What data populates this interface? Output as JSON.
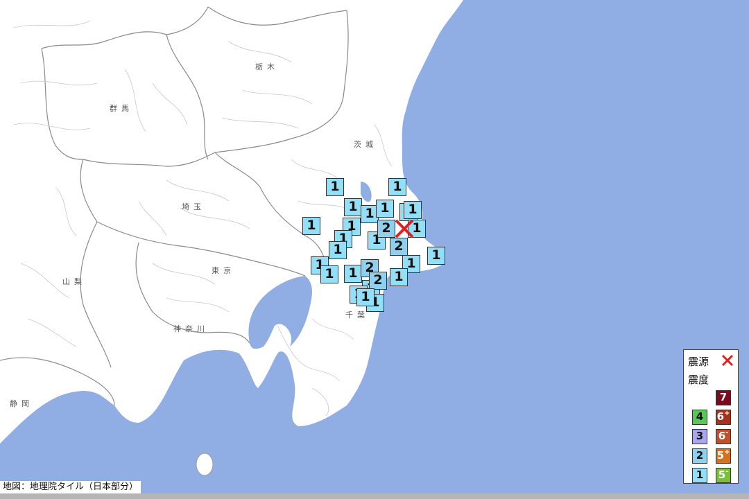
{
  "map": {
    "sea_color": "#91aee4",
    "land_color": "#ffffff",
    "prefectures": [
      {
        "id": "tochigi",
        "label": "栃木"
      },
      {
        "id": "gunma",
        "label": "群馬"
      },
      {
        "id": "ibaraki",
        "label": "茨城"
      },
      {
        "id": "saitama",
        "label": "埼玉"
      },
      {
        "id": "tokyo",
        "label": "東京"
      },
      {
        "id": "yamanashi",
        "label": "山梨"
      },
      {
        "id": "kanagawa",
        "label": "神奈川"
      },
      {
        "id": "chiba",
        "label": "千葉"
      },
      {
        "id": "shizuoka",
        "label": "静岡"
      }
    ],
    "epicenter": {
      "icon": "cross-mark-icon",
      "color": "#e02020"
    },
    "observations": [
      {
        "value": "1"
      },
      {
        "value": "1"
      },
      {
        "value": "1"
      },
      {
        "value": "1"
      },
      {
        "value": "1"
      },
      {
        "value": "1"
      },
      {
        "value": "1"
      },
      {
        "value": "1"
      },
      {
        "value": "1"
      },
      {
        "value": "1"
      },
      {
        "value": "1"
      },
      {
        "value": "1"
      },
      {
        "value": "1"
      },
      {
        "value": "1"
      },
      {
        "value": "1"
      },
      {
        "value": "1"
      },
      {
        "value": "1"
      },
      {
        "value": "1"
      },
      {
        "value": "1"
      },
      {
        "value": "1"
      },
      {
        "value": "1"
      },
      {
        "value": "2"
      },
      {
        "value": "2"
      },
      {
        "value": "2"
      },
      {
        "value": "2"
      },
      {
        "value": "1"
      },
      {
        "value": "1"
      }
    ]
  },
  "legend": {
    "epicenter_label": "震源",
    "intensity_label": "震度",
    "items": [
      {
        "value": "7",
        "color": "#7a0a1e",
        "text_color": "#ffffff"
      },
      {
        "value": "6+",
        "color": "#a3321f",
        "text_color": "#ffffff"
      },
      {
        "value": "6-",
        "color": "#c0502a",
        "text_color": "#ffffff"
      },
      {
        "value": "5+",
        "color": "#d4701e",
        "text_color": "#ffffff"
      },
      {
        "value": "5-",
        "color": "#7cbf3a",
        "text_color": "#ffffff"
      },
      {
        "value": "4",
        "color": "#5ec35a",
        "text_color": "#111111"
      },
      {
        "value": "3",
        "color": "#a8a6ee",
        "text_color": "#111111"
      },
      {
        "value": "2",
        "color": "#8fd0ee",
        "text_color": "#111111"
      },
      {
        "value": "1",
        "color": "#93dff7",
        "text_color": "#111111"
      }
    ]
  },
  "attribution": "地図：地理院タイル（日本部分）"
}
